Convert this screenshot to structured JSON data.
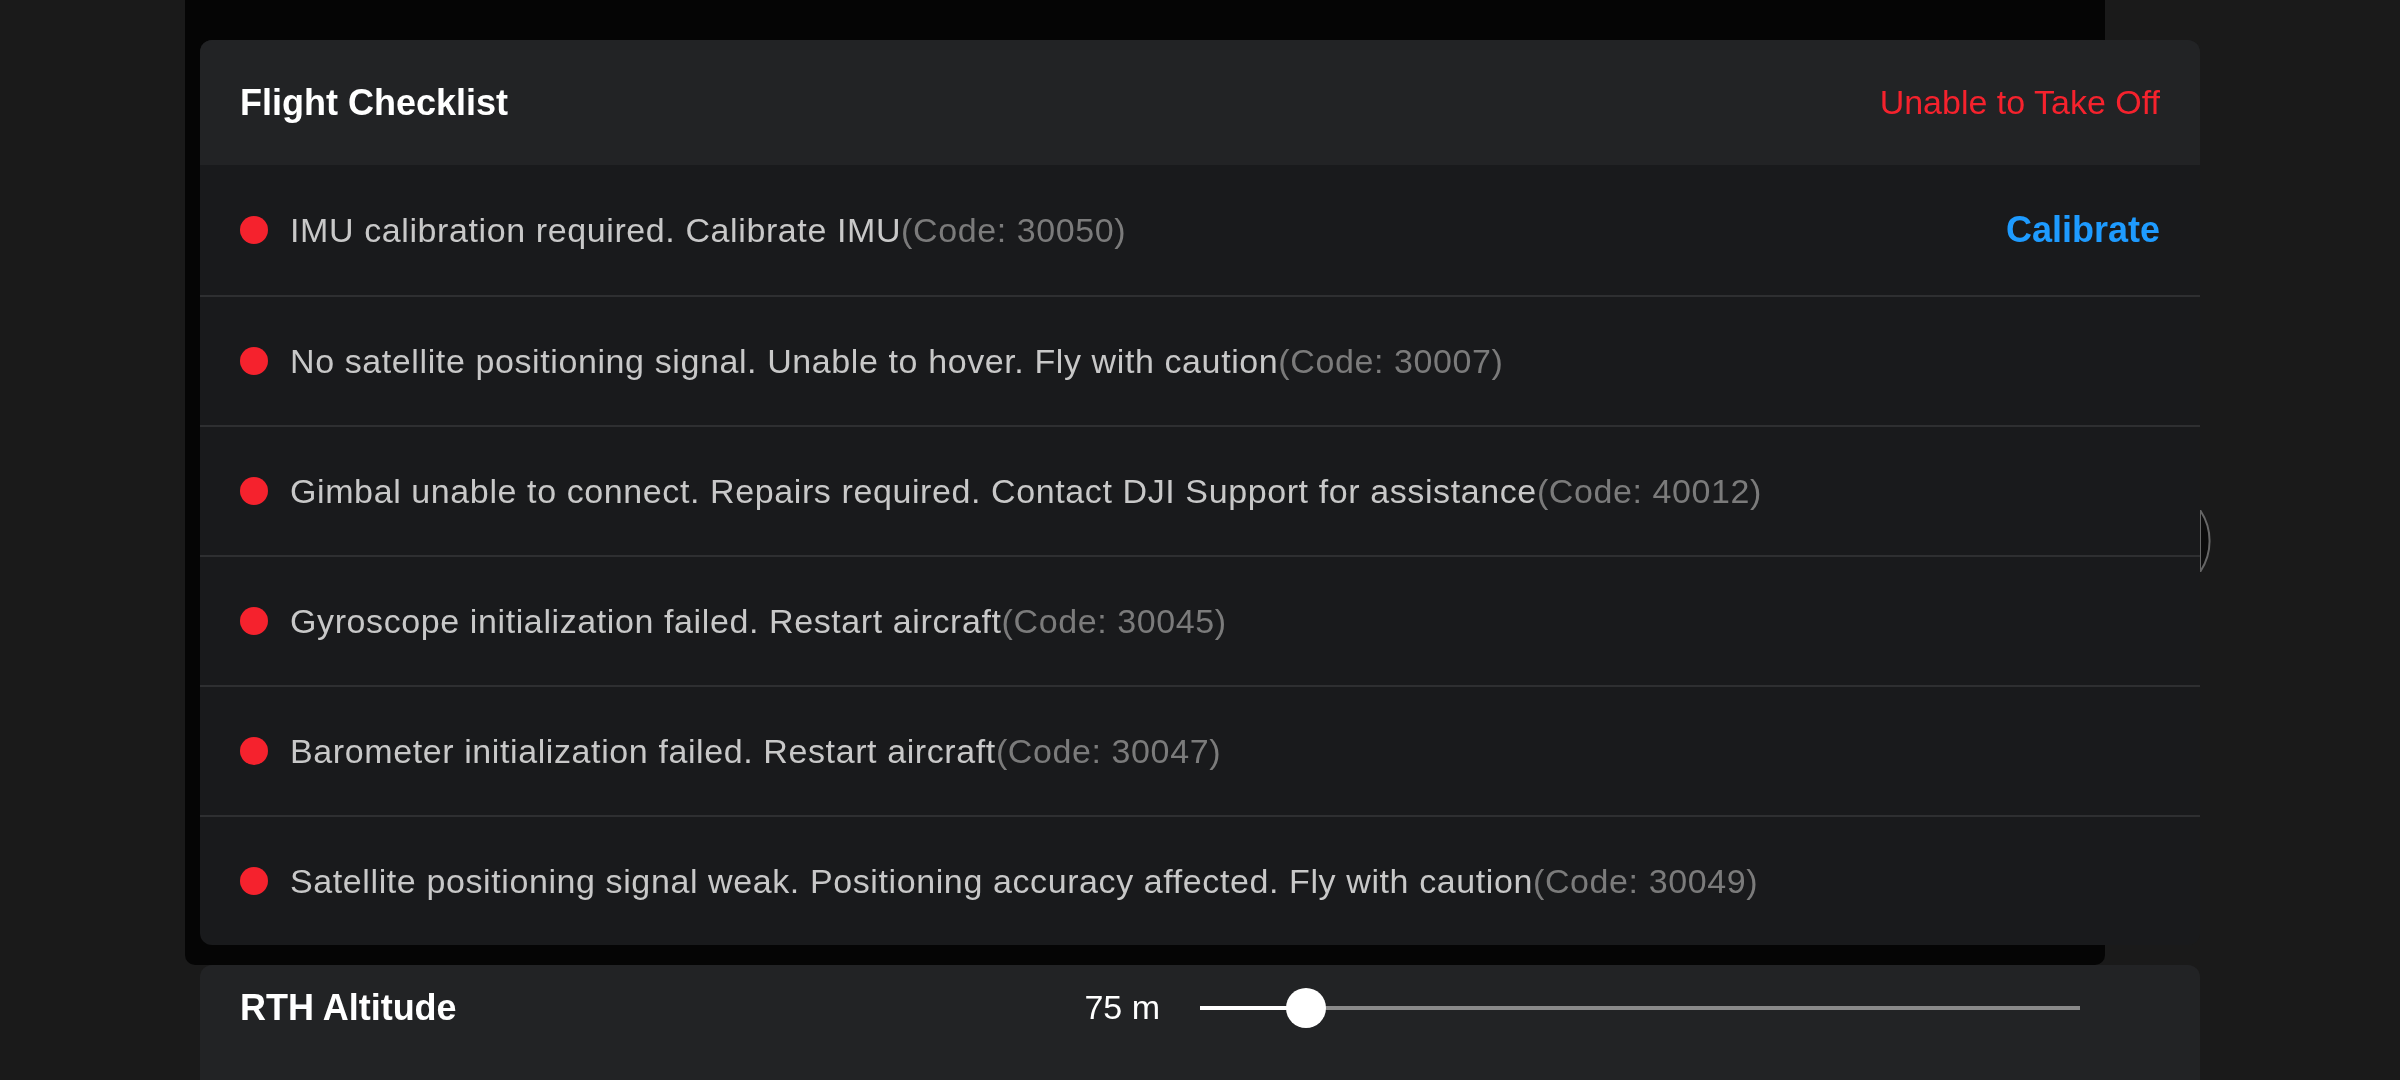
{
  "checklist": {
    "title": "Flight Checklist",
    "status": "Unable to Take Off",
    "items": [
      {
        "message": "IMU calibration required. Calibrate IMU",
        "code": "(Code: 30050)",
        "color": "#f5222d",
        "action": "Calibrate"
      },
      {
        "message": "No satellite positioning signal. Unable to hover. Fly with caution",
        "code": "(Code: 30007)",
        "color": "#f5222d"
      },
      {
        "message": "Gimbal unable to connect. Repairs required. Contact DJI Support for assistance",
        "code": "(Code: 40012)",
        "color": "#f5222d"
      },
      {
        "message": "Gyroscope initialization failed. Restart aircraft",
        "code": "(Code: 30045)",
        "color": "#f5222d"
      },
      {
        "message": "Barometer initialization failed. Restart aircraft",
        "code": "(Code: 30047)",
        "color": "#f5222d"
      },
      {
        "message": "Satellite positioning signal weak. Positioning accuracy affected. Fly with caution",
        "code": "(Code: 30049)",
        "color": "#f5222d"
      }
    ]
  },
  "rth_altitude": {
    "label": "RTH Altitude",
    "reading": "75 m",
    "level": 0.12
  }
}
